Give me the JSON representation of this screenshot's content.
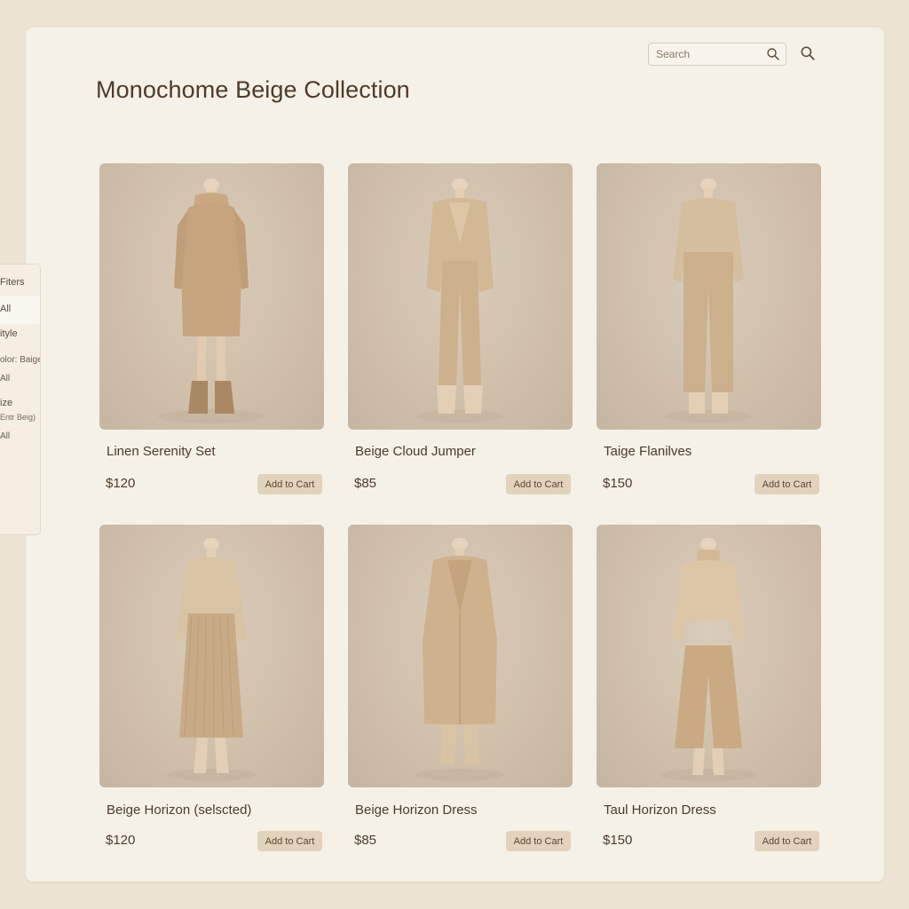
{
  "page": {
    "title": "Monochome Beige Collection"
  },
  "search": {
    "placeholder": "Search"
  },
  "filters": {
    "heading": "Fiters",
    "all": "All",
    "style": "ityle",
    "color": "olor: Baige",
    "color_all": "All",
    "size": "ize",
    "size_value": "Entr Beig)",
    "size_all": "All"
  },
  "colors": {
    "background": "#ede4d5",
    "panel": "#f6f1e7",
    "button": "#e3d3bd",
    "text": "#4b3b2b"
  },
  "products": [
    {
      "name": "Linen Serenity Set",
      "price": "$120",
      "cart": "Add to Cart",
      "garment": "knit sweater dress with boots"
    },
    {
      "name": "Beige Cloud Jumper",
      "price": "$85",
      "cart": "Add to Cart",
      "garment": "blazer and trousers"
    },
    {
      "name": "Taige Flanilves",
      "price": "$150",
      "cart": "Add to Cart",
      "garment": "sweater and wide trousers"
    },
    {
      "name": "Beige Horizon (selscted)",
      "price": "$120",
      "cart": "Add to Cart",
      "garment": "blouse with pleated skirt"
    },
    {
      "name": "Beige Horizon Dress",
      "price": "$85",
      "cart": "Add to Cart",
      "garment": "long trench coat"
    },
    {
      "name": "Taul Horizon Dress",
      "price": "$150",
      "cart": "Add to Cart",
      "garment": "turtleneck with culottes"
    }
  ]
}
